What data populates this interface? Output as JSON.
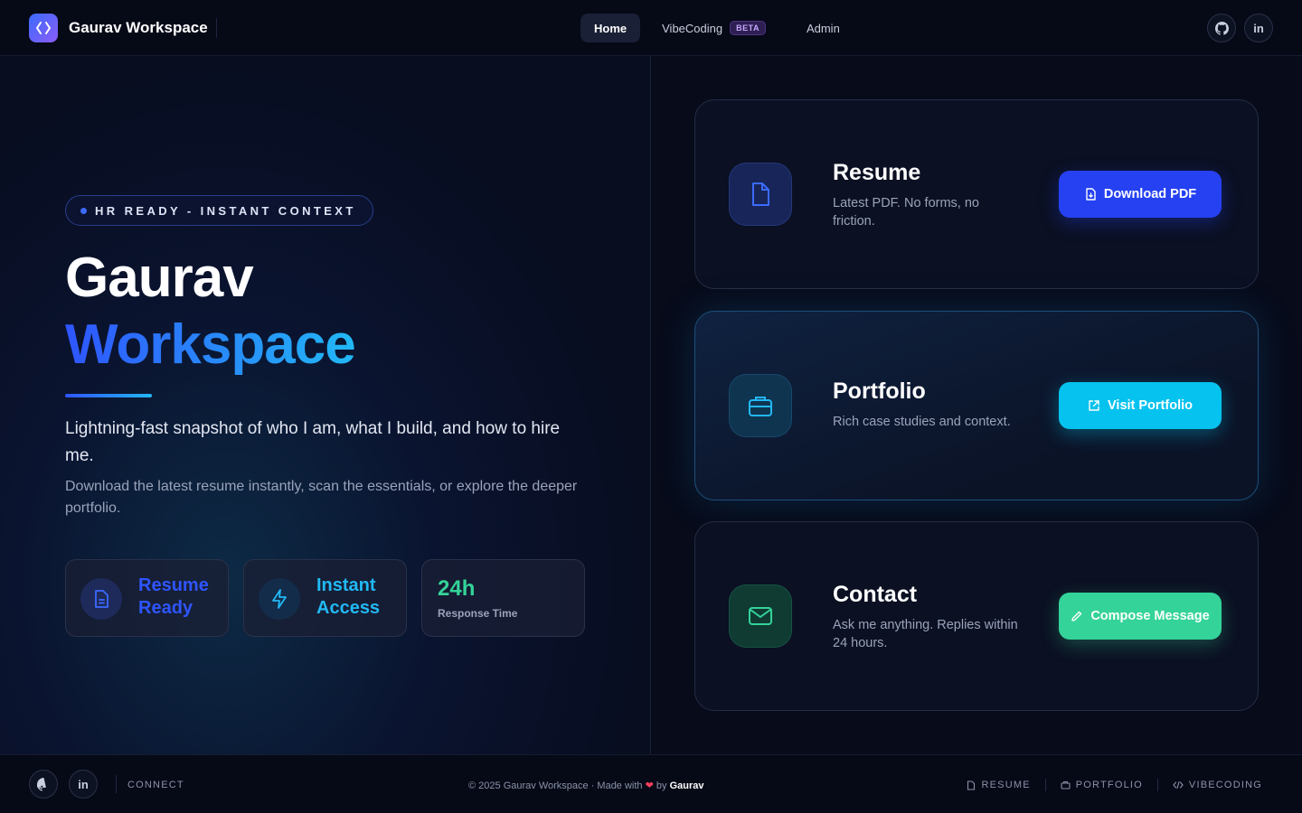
{
  "header": {
    "brand": "Gaurav Workspace",
    "nav": [
      {
        "label": "Home"
      },
      {
        "label": "VibeCoding",
        "badge": "BETA"
      },
      {
        "label": "Admin"
      }
    ],
    "icons": {
      "github": "github-icon",
      "linkedin": "in"
    }
  },
  "hero": {
    "pill": "HR READY - INSTANT CONTEXT",
    "title_line1": "Gaurav",
    "title_line2": "Workspace",
    "lead": "Lightning-fast snapshot of who I am, what I build, and how to hire me.",
    "sub": "Download the latest resume instantly, scan the essentials, or explore the deeper portfolio.",
    "stats": [
      {
        "label": "Resume Ready",
        "icon": "document-icon"
      },
      {
        "label": "Instant Access",
        "icon": "lightning-icon"
      },
      {
        "value": "24h",
        "label": "Response Time"
      }
    ]
  },
  "cards": [
    {
      "title": "Resume",
      "desc": "Latest PDF. No forms, no friction.",
      "cta": "Download PDF",
      "icon": "document-icon",
      "color": "#2563eb"
    },
    {
      "title": "Portfolio",
      "desc": "Rich case studies and context.",
      "cta": "Visit Portfolio",
      "icon": "briefcase-icon",
      "color": "#06c2ee"
    },
    {
      "title": "Contact",
      "desc": "Ask me anything. Replies within 24 hours.",
      "cta": "Compose Message",
      "icon": "mail-icon",
      "color": "#34d399"
    }
  ],
  "footer": {
    "connect": "CONNECT",
    "copy_prefix": "© 2025 Gaurav Workspace · Made with",
    "heart": "❤",
    "copy_by": "by",
    "copy_author": "Gaurav",
    "links": [
      {
        "label": "RESUME"
      },
      {
        "label": "PORTFOLIO"
      },
      {
        "label": "VIBECODING"
      }
    ],
    "linkedin": "in"
  },
  "colors": {
    "accent_blue": "#2f55ff",
    "accent_cyan": "#22b8f5",
    "accent_green": "#34d399",
    "background": "#070b1a"
  }
}
